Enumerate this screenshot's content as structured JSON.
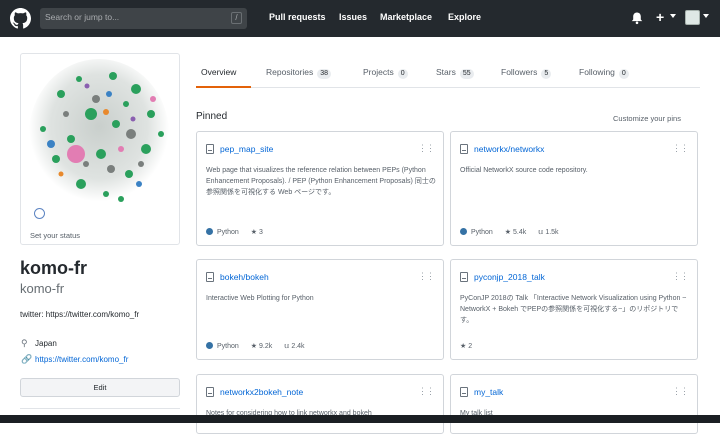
{
  "header": {
    "search_placeholder": "Search or jump to...",
    "search_key": "/",
    "nav": [
      "Pull requests",
      "Issues",
      "Marketplace",
      "Explore"
    ],
    "plus": "+"
  },
  "profile": {
    "status": "Set your status",
    "name": "komo-fr",
    "login": "komo-fr",
    "bio": "twitter: https://twitter.com/komo_fr",
    "location": "Japan",
    "website": "https://twitter.com/komo_fr",
    "edit_label": "Edit"
  },
  "tabs": [
    {
      "label": "Overview",
      "count": null
    },
    {
      "label": "Repositories",
      "count": "38"
    },
    {
      "label": "Projects",
      "count": "0"
    },
    {
      "label": "Stars",
      "count": "55"
    },
    {
      "label": "Followers",
      "count": "5"
    },
    {
      "label": "Following",
      "count": "0"
    }
  ],
  "pinned": {
    "heading": "Pinned",
    "customize": "Customize your pins",
    "repos": [
      {
        "name": "pep_map_site",
        "desc": "Web page that visualizes the reference relation between PEPs (Python Enhancement Proposals). / PEP (Python Enhancement Proposals) 同士の参照関係を可視化する Web ページです。",
        "lang": "Python",
        "stars": "3",
        "forks": ""
      },
      {
        "name": "networkx/networkx",
        "desc": "Official NetworkX source code repository.",
        "lang": "Python",
        "stars": "5.4k",
        "forks": "1.5k"
      },
      {
        "name": "bokeh/bokeh",
        "desc": "Interactive Web Plotting for Python",
        "lang": "Python",
        "stars": "9.2k",
        "forks": "2.4k"
      },
      {
        "name": "pyconjp_2018_talk",
        "desc": "PyConJP 2018の Talk 「Interactive Network Visualization using Python ~ NetworkX + Bokeh でPEPの参照関係を可視化する~」のリポジトリです。",
        "lang": "",
        "stars": "2",
        "forks": ""
      },
      {
        "name": "networkx2bokeh_note",
        "desc": "Notes for considering how to link networkx and bokeh",
        "lang": "",
        "stars": "",
        "forks": ""
      },
      {
        "name": "my_talk",
        "desc": "My talk list",
        "lang": "",
        "stars": "",
        "forks": ""
      }
    ]
  },
  "colors": {
    "topbar": "#24292e",
    "link": "#0366d6",
    "active_tab": "#e36209",
    "python": "#3572a5"
  }
}
